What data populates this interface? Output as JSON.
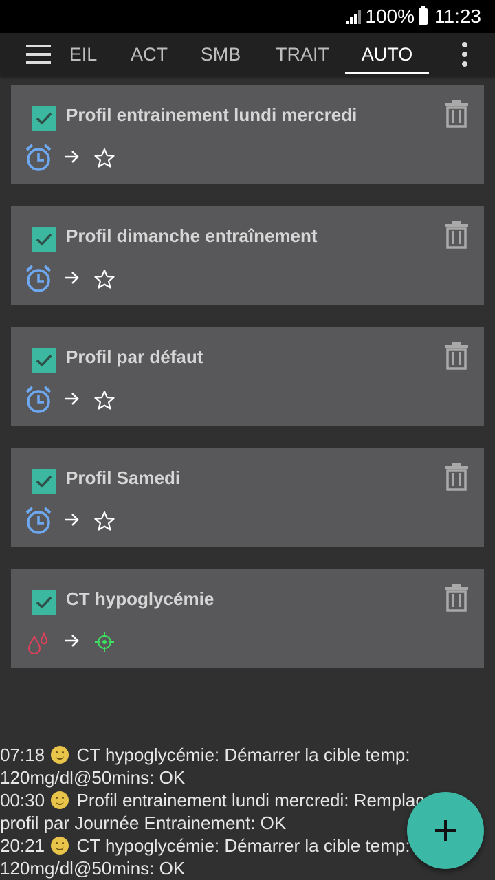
{
  "status_bar": {
    "battery": "100%",
    "time": "11:23"
  },
  "tabs": [
    {
      "label": "EIL",
      "active": false
    },
    {
      "label": "ACT",
      "active": false
    },
    {
      "label": "SMB",
      "active": false
    },
    {
      "label": "TRAIT",
      "active": false
    },
    {
      "label": "AUTO",
      "active": true
    }
  ],
  "automations": [
    {
      "title": "Profil entrainement lundi mercredi",
      "enabled": true,
      "trigger_icon": "alarm-clock-icon",
      "action_icon": "star-icon"
    },
    {
      "title": "Profil dimanche entraînement",
      "enabled": true,
      "trigger_icon": "alarm-clock-icon",
      "action_icon": "star-icon"
    },
    {
      "title": "Profil par défaut",
      "enabled": true,
      "trigger_icon": "alarm-clock-icon",
      "action_icon": "star-icon"
    },
    {
      "title": "Profil Samedi",
      "enabled": true,
      "trigger_icon": "alarm-clock-icon",
      "action_icon": "star-icon"
    },
    {
      "title": "CT hypoglycémie",
      "enabled": true,
      "trigger_icon": "blood-drops-icon",
      "action_icon": "target-icon"
    }
  ],
  "log": {
    "lines": [
      {
        "time": "07:18",
        "text": "CT hypoglycémie: Démarrer la cible temp:"
      },
      {
        "time": "",
        "text": "120mg/dl@50mins: OK"
      },
      {
        "time": "00:30",
        "text": "Profil entrainement lundi mercredi: Remplacer le"
      },
      {
        "time": "",
        "text": "profil par Journée Entrainement: OK"
      },
      {
        "time": "20:21",
        "text": "CT hypoglycémie: Démarrer la cible temp:"
      },
      {
        "time": "",
        "text": "120mg/dl@50mins: OK"
      }
    ]
  },
  "colors": {
    "accent": "#3cb8a0",
    "card_bg": "#58585a",
    "clock_blue": "#6ea8f0",
    "drop_red": "#e0405a",
    "target_green": "#3ee060"
  }
}
